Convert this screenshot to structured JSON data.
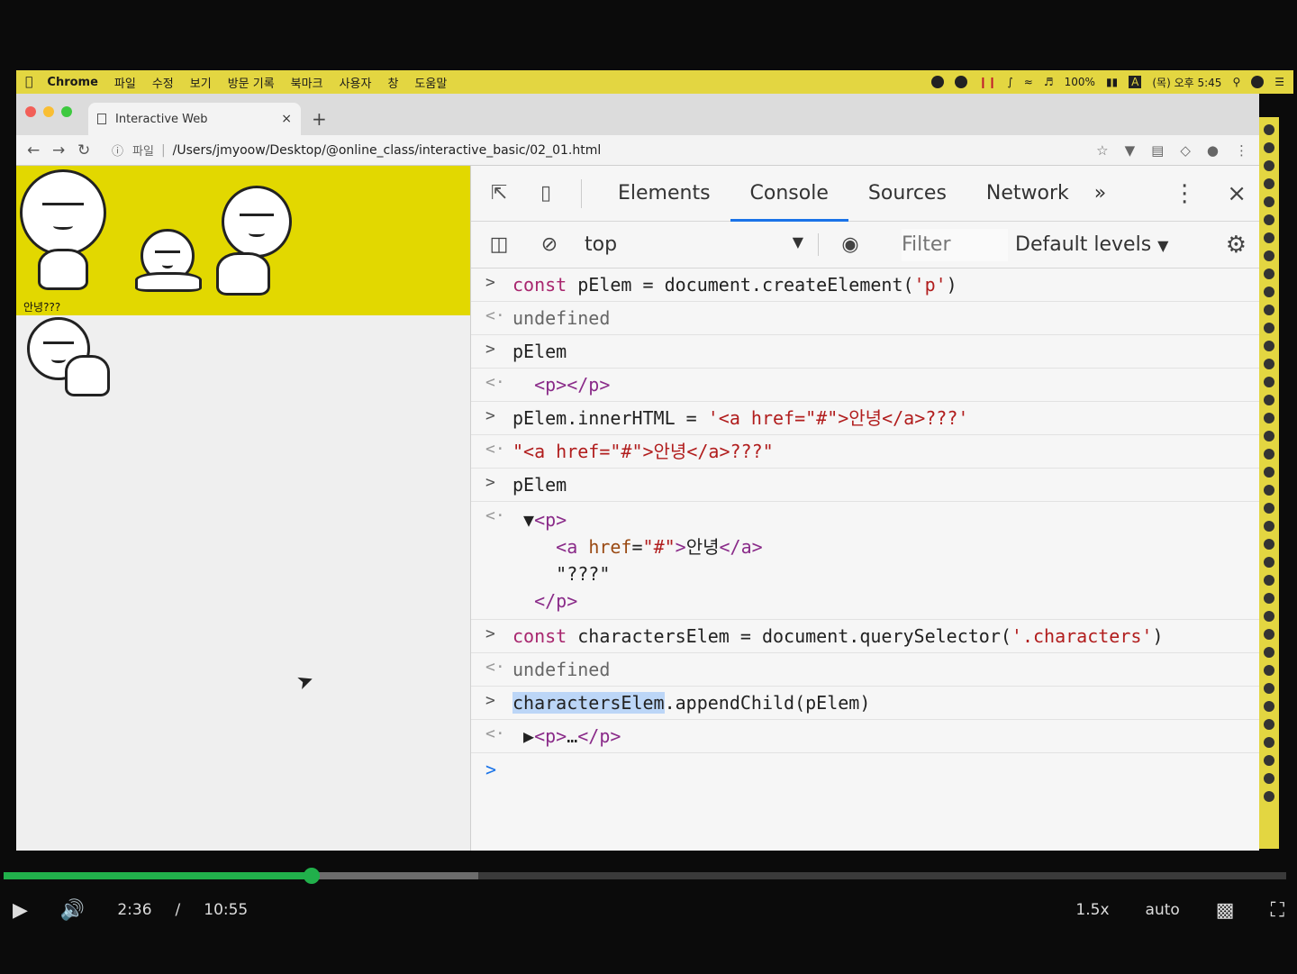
{
  "menubar": {
    "app": "Chrome",
    "items": [
      "파일",
      "수정",
      "보기",
      "방문 기록",
      "북마크",
      "사용자",
      "창",
      "도움말"
    ],
    "battery": "100%",
    "clock": "(목) 오후 5:45"
  },
  "browser": {
    "tab_title": "Interactive Web",
    "address_prefix": "파일",
    "url": "/Users/jmyoow/Desktop/@online_class/interactive_basic/02_01.html"
  },
  "page": {
    "appended_text": "안녕???"
  },
  "devtools": {
    "tabs": [
      {
        "label": "Elements",
        "active": false
      },
      {
        "label": "Console",
        "active": true
      },
      {
        "label": "Sources",
        "active": false
      },
      {
        "label": "Network",
        "active": false
      }
    ],
    "context": "top",
    "filter_placeholder": "Filter",
    "levels": "Default levels"
  },
  "video": {
    "current_time": "2:36",
    "separator": "/",
    "duration": "10:55",
    "speed": "1.5x",
    "quality": "auto",
    "played_fraction": 0.24,
    "buffered_fraction": 0.37
  },
  "colors": {
    "banner_yellow": "#e2d800",
    "active_tab_blue": "#1a73e8",
    "progress_green": "#21b04b"
  }
}
